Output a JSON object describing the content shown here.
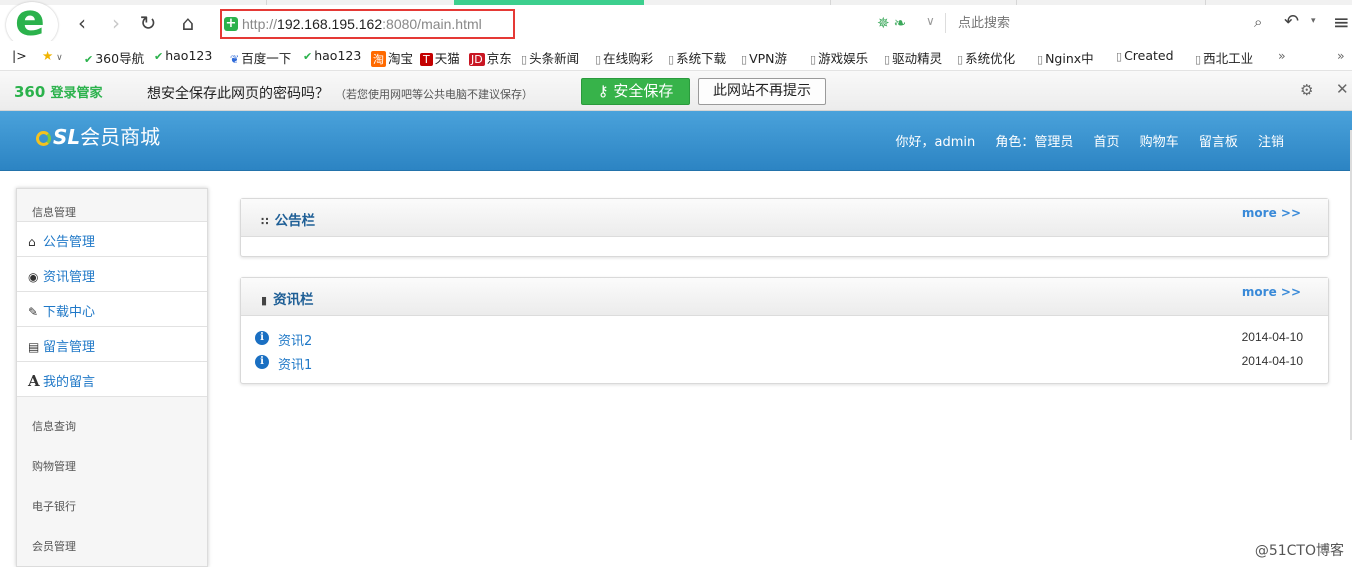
{
  "browser": {
    "logo_letter": "e",
    "address": {
      "scheme": "http://",
      "host": "192.168.195.162",
      "rest": ":8080/main.html"
    },
    "search_placeholder": "点此搜索",
    "bookmarks": [
      {
        "icon": "star-icon",
        "label": ""
      },
      {
        "icon": "hao-icon",
        "label": "360导航"
      },
      {
        "icon": "hao-icon",
        "label": "hao123"
      },
      {
        "icon": "paw-icon",
        "label": "百度一下"
      },
      {
        "icon": "hao-icon",
        "label": "hao123"
      },
      {
        "icon": "taobao-icon",
        "label": "淘宝"
      },
      {
        "icon": "tmall-icon",
        "label": "天猫"
      },
      {
        "icon": "jd-icon",
        "label": "京东"
      },
      {
        "icon": "page-icon",
        "label": "头条新闻"
      },
      {
        "icon": "page-icon",
        "label": "在线购彩"
      },
      {
        "icon": "page-icon",
        "label": "系统下载"
      },
      {
        "icon": "page-icon",
        "label": "VPN游"
      },
      {
        "icon": "page-icon",
        "label": "游戏娱乐"
      },
      {
        "icon": "page-icon",
        "label": "驱动精灵"
      },
      {
        "icon": "page-icon",
        "label": "系统优化"
      },
      {
        "icon": "page-icon",
        "label": "Nginx中"
      },
      {
        "icon": "page-icon",
        "label": "Created"
      },
      {
        "icon": "page-icon",
        "label": "西北工业"
      }
    ]
  },
  "pwbar": {
    "brand_num": "360",
    "brand_text": "登录管家",
    "question": "想安全保存此网页的密码吗？",
    "hint": "（若您使用网吧等公共电脑不建议保存）",
    "save_label": "安全保存",
    "never_label": "此网站不再提示"
  },
  "site": {
    "logo_mark": "SL",
    "logo_text": "会员商城",
    "greeting": "你好，admin",
    "role": "角色：管理员",
    "nav": [
      "首页",
      "购物车",
      "留言板",
      "注销"
    ]
  },
  "sidebar": {
    "group1": "信息管理",
    "items": [
      "公告管理",
      "资讯管理",
      "下载中心",
      "留言管理",
      "我的留言"
    ],
    "groups": [
      "信息查询",
      "购物管理",
      "电子银行",
      "会员管理"
    ]
  },
  "notice": {
    "title": "公告栏",
    "more": "more >>"
  },
  "news": {
    "title": "资讯栏",
    "more": "more >>",
    "rows": [
      {
        "title": "资讯2",
        "date": "2014-04-10"
      },
      {
        "title": "资讯1",
        "date": "2014-04-10"
      }
    ]
  },
  "watermark": "@51CTO博客"
}
